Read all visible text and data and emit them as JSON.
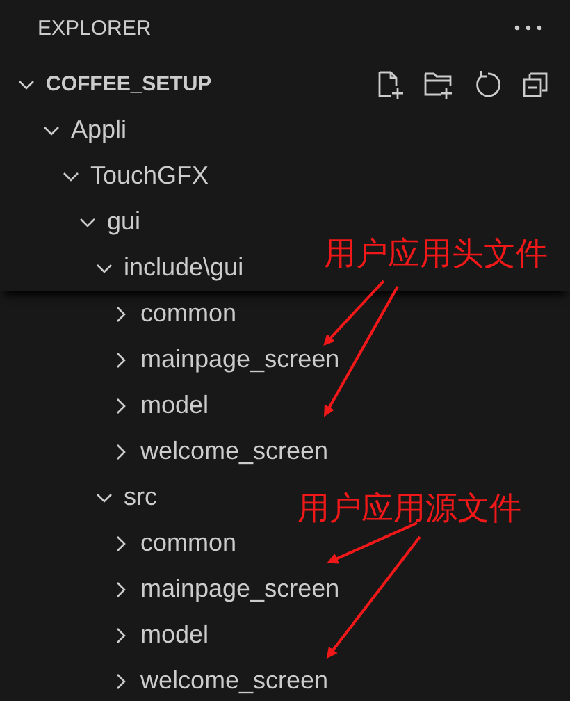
{
  "header": {
    "title": "EXPLORER"
  },
  "tree": [
    {
      "label": "COFFEE_SETUP",
      "expanded": true,
      "children": [
        {
          "label": "Appli",
          "expanded": true,
          "children": [
            {
              "label": "TouchGFX",
              "expanded": true,
              "children": [
                {
                  "label": "gui",
                  "expanded": true,
                  "children": [
                    {
                      "label": "include\\gui",
                      "expanded": true,
                      "children": [
                        {
                          "label": "common",
                          "expanded": false
                        },
                        {
                          "label": "mainpage_screen",
                          "expanded": false
                        },
                        {
                          "label": "model",
                          "expanded": false
                        },
                        {
                          "label": "welcome_screen",
                          "expanded": false
                        }
                      ]
                    },
                    {
                      "label": "src",
                      "expanded": true,
                      "children": [
                        {
                          "label": "common",
                          "expanded": false
                        },
                        {
                          "label": "mainpage_screen",
                          "expanded": false
                        },
                        {
                          "label": "model",
                          "expanded": false
                        },
                        {
                          "label": "welcome_screen",
                          "expanded": false
                        }
                      ]
                    }
                  ]
                }
              ]
            }
          ]
        }
      ]
    }
  ],
  "annotations": [
    {
      "text": "用户应用头文件"
    },
    {
      "text": "用户应用源文件"
    }
  ]
}
